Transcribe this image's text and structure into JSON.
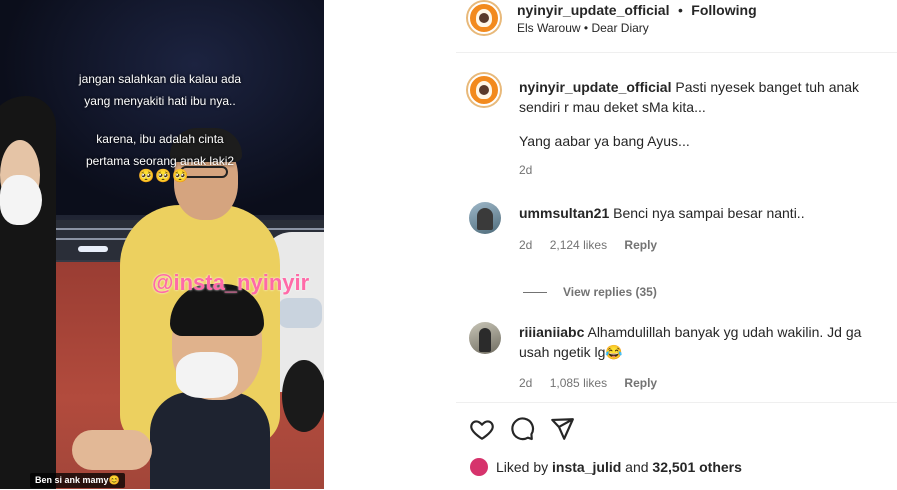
{
  "video": {
    "overlay_line1": "jangan salahkan dia kalau ada\nyang menyakiti hati ibu nya..",
    "overlay_line2": "karena, ibu adalah cinta\npertama seorang anak laki2",
    "emojis": "🥺🥺🥺",
    "watermark": "@insta_nyinyir",
    "caption_tag": "Ben si ank mamy😊"
  },
  "header": {
    "username": "nyinyir_update_official",
    "separator": "•",
    "follow_state": "Following",
    "audio": "Els Warouw • Dear Diary"
  },
  "caption": {
    "username": "nyinyir_update_official",
    "text": "Pasti nyesek banget tuh anak sendiri r mau deket sMa kita...",
    "text2": "Yang aabar ya bang Ayus...",
    "time": "2d"
  },
  "comments": [
    {
      "username": "ummsultan21",
      "text": "Benci nya sampai besar nanti..",
      "time": "2d",
      "likes": "2,124 likes",
      "reply": "Reply"
    },
    {
      "username": "riiianiiabc",
      "text": "Alhamdulillah banyak yg udah wakilin. Jd ga usah ngetik lg😂",
      "time": "2d",
      "likes": "1,085 likes",
      "reply": "Reply"
    }
  ],
  "view_replies": "View replies (35)",
  "actions": {
    "like_icon": "heart-icon",
    "comment_icon": "comment-icon",
    "share_icon": "share-icon"
  },
  "liked_by": {
    "prefix": "Liked by",
    "user": "insta_julid",
    "middle": "and",
    "others": "32,501 others"
  },
  "colors": {
    "avatar_orange": "#f28a1e",
    "text": "#262626",
    "muted": "#737373",
    "watermark": "#ff6aa8"
  }
}
